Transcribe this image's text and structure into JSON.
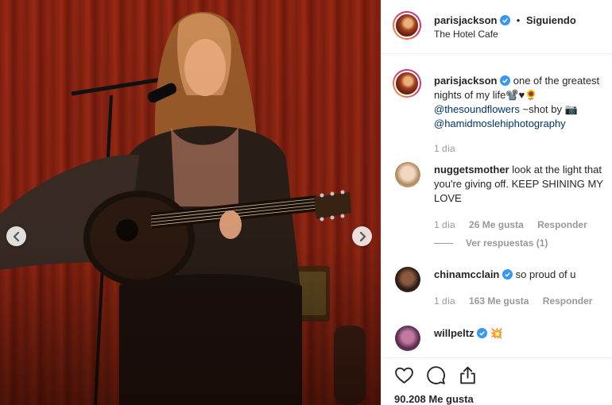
{
  "header": {
    "username": "parisjackson",
    "separator": "•",
    "follow_status": "Siguiendo",
    "location": "The Hotel Cafe"
  },
  "caption": {
    "username": "parisjackson",
    "text": "one of the greatest nights of my life",
    "emojis": "📽️♥🌻",
    "mention1": "@thesoundflowers",
    "shot_by": "~shot by",
    "camera_emoji": "📷",
    "mention2": "@hamidmoslehiphotography",
    "time": "1 día"
  },
  "comments": [
    {
      "username": "nuggetsmother",
      "text": "look at the light that you're giving off. KEEP SHINING MY LOVE",
      "time": "1 día",
      "likes": "26 Me gusta",
      "reply": "Responder",
      "view_replies": "Ver respuestas (1)"
    },
    {
      "username": "chinamcclain",
      "text": "so proud of u",
      "time": "1 día",
      "likes": "163 Me gusta",
      "reply": "Responder"
    },
    {
      "username": "willpeltz",
      "text": "💥"
    }
  ],
  "footer": {
    "likes": "90.208 Me gusta"
  },
  "icons": {
    "prev": "chevron-left-icon",
    "next": "chevron-right-icon",
    "like": "heart-icon",
    "comment": "comment-icon",
    "share": "share-icon",
    "verified": "verified-badge-icon"
  },
  "colors": {
    "verified": "#3897f0",
    "link": "#003569",
    "muted": "#999999"
  }
}
